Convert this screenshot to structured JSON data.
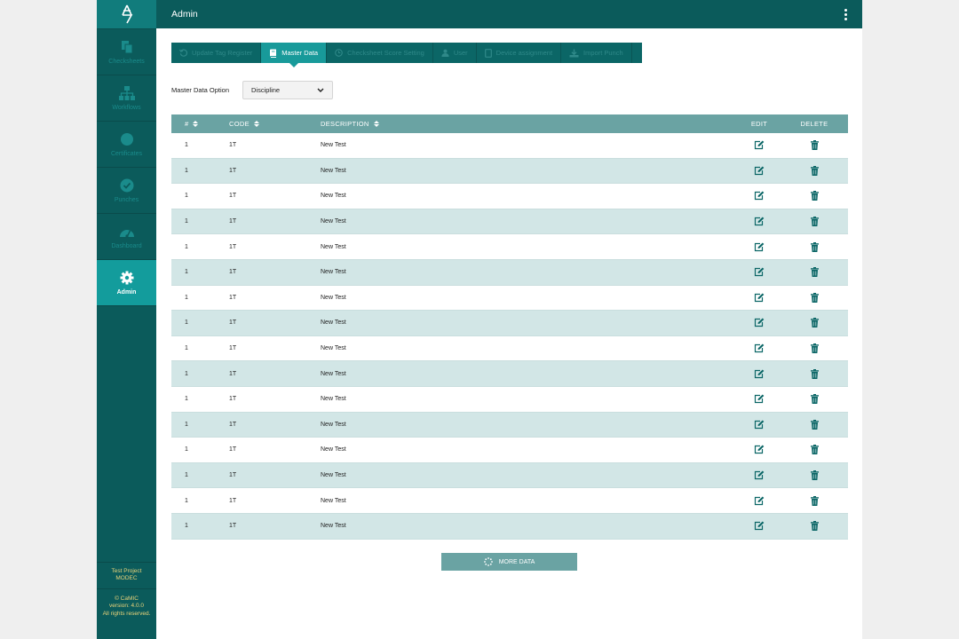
{
  "header": {
    "title": "Admin"
  },
  "sidebar": {
    "items": [
      {
        "label": "Checksheets",
        "icon": "files-icon"
      },
      {
        "label": "Workflows",
        "icon": "sitemap-icon"
      },
      {
        "label": "Certificates",
        "icon": "certificate-icon"
      },
      {
        "label": "Punches",
        "icon": "check-circle-icon"
      },
      {
        "label": "Dashboard",
        "icon": "gauge-icon"
      },
      {
        "label": "Admin",
        "icon": "gear-icon",
        "active": true
      }
    ],
    "project_line1": "Test Project",
    "project_line2": "MODEC",
    "copyright": "© CaMIC",
    "version": "version: 4.0.0",
    "rights": "All rights reserved."
  },
  "tabs": [
    {
      "label": "Update Tag Register",
      "icon": "undo-icon"
    },
    {
      "label": "Master Data",
      "icon": "book-icon",
      "active": true
    },
    {
      "label": "Checksheet Score Setting",
      "icon": "clock-icon"
    },
    {
      "label": "User",
      "icon": "user-icon"
    },
    {
      "label": "Device assignment",
      "icon": "tablet-icon"
    },
    {
      "label": "Import Punch",
      "icon": "download-icon"
    }
  ],
  "master_data": {
    "label": "Master Data Option",
    "selected": "Discipline"
  },
  "table": {
    "headers": {
      "num": "#",
      "code": "CODE",
      "description": "DESCRIPTION",
      "edit": "EDIT",
      "delete": "DELETE"
    },
    "rows": [
      {
        "num": "1",
        "code": "1T",
        "description": "New Test"
      },
      {
        "num": "1",
        "code": "1T",
        "description": "New Test"
      },
      {
        "num": "1",
        "code": "1T",
        "description": "New Test"
      },
      {
        "num": "1",
        "code": "1T",
        "description": "New Test"
      },
      {
        "num": "1",
        "code": "1T",
        "description": "New Test"
      },
      {
        "num": "1",
        "code": "1T",
        "description": "New Test"
      },
      {
        "num": "1",
        "code": "1T",
        "description": "New Test"
      },
      {
        "num": "1",
        "code": "1T",
        "description": "New Test"
      },
      {
        "num": "1",
        "code": "1T",
        "description": "New Test"
      },
      {
        "num": "1",
        "code": "1T",
        "description": "New Test"
      },
      {
        "num": "1",
        "code": "1T",
        "description": "New Test"
      },
      {
        "num": "1",
        "code": "1T",
        "description": "New Test"
      },
      {
        "num": "1",
        "code": "1T",
        "description": "New Test"
      },
      {
        "num": "1",
        "code": "1T",
        "description": "New Test"
      },
      {
        "num": "1",
        "code": "1T",
        "description": "New Test"
      },
      {
        "num": "1",
        "code": "1T",
        "description": "New Test"
      }
    ]
  },
  "more_button": {
    "label": "MORE DATA"
  },
  "colors": {
    "primary": "#0b5b5b",
    "accent": "#139c9c",
    "header_row": "#6aa3a3",
    "alt_row": "#d2e6e6",
    "footer_text": "#e8d37a"
  }
}
